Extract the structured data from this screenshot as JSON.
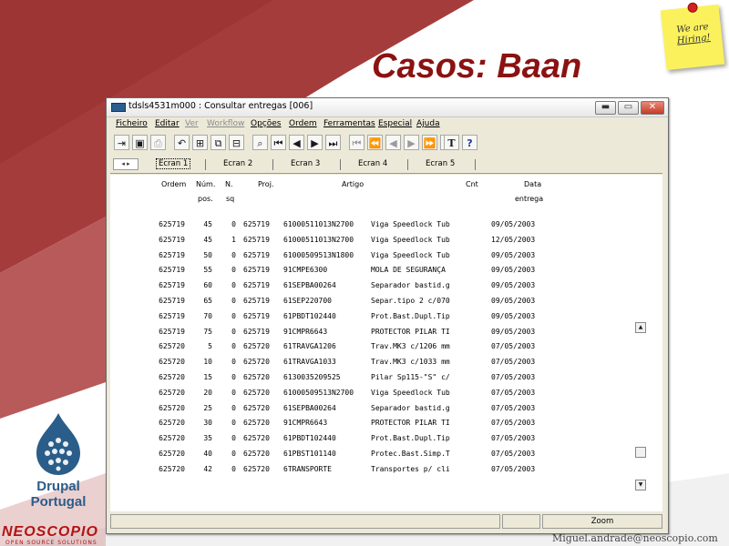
{
  "slide": {
    "title": "Casos: Baan",
    "sticky_note": [
      "We are",
      "Hiring!"
    ],
    "drupal_line1": "Drupal",
    "drupal_line2": "Portugal",
    "brand": "NEOSCOPIO",
    "brand_sub": "OPEN SOURCE SOLUTIONS",
    "email": "Miguel.andrade@neoscopio.com",
    "colors": {
      "title": "#8b1212",
      "background_band": "#a33a3a",
      "drupal": "#2b5d8a"
    }
  },
  "window": {
    "title": "tdsls4531m000 : Consultar entregas [006]",
    "controls": {
      "minimize": "▬",
      "maximize": "▭",
      "close": "✕"
    },
    "menu": [
      {
        "label": "Ficheiro",
        "enabled": true
      },
      {
        "label": "Editar",
        "enabled": true
      },
      {
        "label": "Ver",
        "enabled": false
      },
      {
        "label": "Workflow",
        "enabled": false
      },
      {
        "label": "Opções",
        "enabled": true
      },
      {
        "label": "Ordem",
        "enabled": true
      },
      {
        "label": "Ferramentas",
        "enabled": true
      },
      {
        "label": "Especial",
        "enabled": true
      },
      {
        "label": "Ajuda",
        "enabled": true
      }
    ],
    "toolbar": [
      {
        "name": "exit-icon",
        "glyph": "⇥",
        "enabled": true
      },
      {
        "name": "save-icon",
        "glyph": "▣",
        "enabled": true
      },
      {
        "name": "print-icon",
        "glyph": "⎙",
        "enabled": false
      },
      {
        "name": "undo-icon",
        "glyph": "↶",
        "enabled": true
      },
      {
        "name": "tree-icon",
        "glyph": "⊞",
        "enabled": true
      },
      {
        "name": "copy-icon",
        "glyph": "⧉",
        "enabled": true
      },
      {
        "name": "tree2-icon",
        "glyph": "⊟",
        "enabled": true
      },
      {
        "name": "find-icon",
        "glyph": "⌕",
        "enabled": true
      },
      {
        "name": "first-record-icon",
        "glyph": "⏮",
        "enabled": true
      },
      {
        "name": "prev-record-icon",
        "glyph": "◀",
        "enabled": true
      },
      {
        "name": "next-record-icon",
        "glyph": "▶",
        "enabled": true
      },
      {
        "name": "last-record-icon",
        "glyph": "⏭",
        "enabled": true
      },
      {
        "name": "first-set-icon",
        "glyph": "⏮",
        "enabled": false
      },
      {
        "name": "prev-set-icon",
        "glyph": "⏪",
        "enabled": false
      },
      {
        "name": "prev-page-icon",
        "glyph": "◀",
        "enabled": false
      },
      {
        "name": "next-page-icon",
        "glyph": "▶",
        "enabled": false
      },
      {
        "name": "next-set-icon",
        "glyph": "⏩",
        "enabled": false
      },
      {
        "name": "last-set-icon",
        "glyph": "⏭",
        "enabled": false
      },
      {
        "name": "text-icon",
        "glyph": "T",
        "enabled": true
      },
      {
        "name": "help-icon",
        "glyph": "?",
        "enabled": true
      }
    ],
    "tabs": [
      "Ecran 1",
      "Ecran 2",
      "Ecran 3",
      "Ecran 4",
      "Ecran 5"
    ],
    "tab_arrows": "◂ ▸",
    "columns": {
      "ordem": "Ordem",
      "num": [
        "Núm.",
        "pos."
      ],
      "n": [
        "N.",
        "sq"
      ],
      "proj": "Proj.",
      "artigo": "Artigo",
      "cnt": "Cnt",
      "data": [
        "Data",
        "entrega"
      ]
    },
    "rows": [
      [
        "625719",
        "45",
        "0",
        "625719",
        "61000511013N2700",
        "Viga Speedlock Tub",
        "09/05/2003"
      ],
      [
        "625719",
        "45",
        "1",
        "625719",
        "61000511013N2700",
        "Viga Speedlock Tub",
        "12/05/2003"
      ],
      [
        "625719",
        "50",
        "0",
        "625719",
        "61000509513N1800",
        "Viga Speedlock Tub",
        "09/05/2003"
      ],
      [
        "625719",
        "55",
        "0",
        "625719",
        "91CMPE6300",
        "MOLA DE SEGURANÇA",
        "09/05/2003"
      ],
      [
        "625719",
        "60",
        "0",
        "625719",
        "61SEPBA00264",
        "Separador bastid.g",
        "09/05/2003"
      ],
      [
        "625719",
        "65",
        "0",
        "625719",
        "61SEP220700",
        "Separ.tipo 2 c/070",
        "09/05/2003"
      ],
      [
        "625719",
        "70",
        "0",
        "625719",
        "61PBDT102440",
        "Prot.Bast.Dupl.Tip",
        "09/05/2003"
      ],
      [
        "625719",
        "75",
        "0",
        "625719",
        "91CMPR6643",
        "PROTECTOR PILAR TI",
        "09/05/2003"
      ],
      [
        "625720",
        "5",
        "0",
        "625720",
        "61TRAVGA1206",
        "Trav.MK3 c/1206 mm",
        "07/05/2003"
      ],
      [
        "625720",
        "10",
        "0",
        "625720",
        "61TRAVGA1033",
        "Trav.MK3 c/1033 mm",
        "07/05/2003"
      ],
      [
        "625720",
        "15",
        "0",
        "625720",
        "6130035209525",
        "Pilar Sp115-\"S\" c/",
        "07/05/2003"
      ],
      [
        "625720",
        "20",
        "0",
        "625720",
        "61000509513N2700",
        "Viga Speedlock Tub",
        "07/05/2003"
      ],
      [
        "625720",
        "25",
        "0",
        "625720",
        "61SEPBA00264",
        "Separador bastid.g",
        "07/05/2003"
      ],
      [
        "625720",
        "30",
        "0",
        "625720",
        "91CMPR6643",
        "PROTECTOR PILAR TI",
        "07/05/2003"
      ],
      [
        "625720",
        "35",
        "0",
        "625720",
        "61PBDT102440",
        "Prot.Bast.Dupl.Tip",
        "07/05/2003"
      ],
      [
        "625720",
        "40",
        "0",
        "625720",
        "61PBST101140",
        "Protec.Bast.Simp.T",
        "07/05/2003"
      ],
      [
        "625720",
        "42",
        "0",
        "625720",
        "6TRANSPORTE",
        "Transportes p/ cli",
        "07/05/2003"
      ]
    ],
    "scroll": {
      "up": "▲",
      "down": "▼"
    },
    "status_zoom": "Zoom"
  }
}
